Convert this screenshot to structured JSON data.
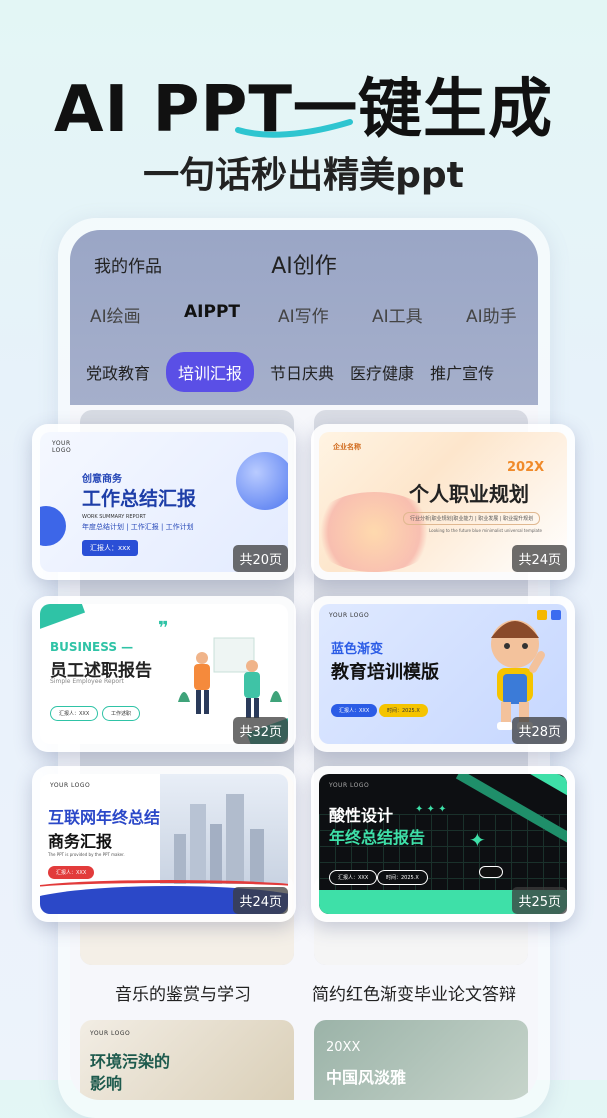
{
  "headline": "AI PPT一键生成",
  "subline": "一句话秒出精美ppt",
  "header": {
    "left": "我的作品",
    "title": "AI创作"
  },
  "tabs": [
    {
      "label": "AI绘画",
      "active": false
    },
    {
      "label": "AIPPT",
      "active": true
    },
    {
      "label": "AI写作",
      "active": false
    },
    {
      "label": "AI工具",
      "active": false
    },
    {
      "label": "AI助手",
      "active": false
    }
  ],
  "categories": [
    {
      "label": "党政教育",
      "active": false
    },
    {
      "label": "培训汇报",
      "active": true
    },
    {
      "label": "节日庆典",
      "active": false
    },
    {
      "label": "医疗健康",
      "active": false
    },
    {
      "label": "推广宣传",
      "active": false
    }
  ],
  "accent": "#5a4fe6",
  "templates": [
    {
      "pages": "共20页",
      "logo": "YOUR LOGO",
      "small": "创意商务",
      "title": "工作总结汇报",
      "en": "WORK SUMMARY REPORT",
      "items": "年度总结计划 | 工作汇报 | 工作计划",
      "reporter": "汇报人：xxx"
    },
    {
      "pages": "共24页",
      "company": "企业名称",
      "year": "202X",
      "title": "个人职业规划",
      "desc": "行业分析|职业规划|职业能力 | 职业发展 | 职业提升规划",
      "en": "Looking to the future blue minimalist universal template"
    },
    {
      "pages": "共32页",
      "title_en": "BUSINESS —",
      "title": "员工述职报告",
      "sub": "Simple Employee Report",
      "reporter": "汇报人：XXX",
      "dept": "工作述职"
    },
    {
      "pages": "共28页",
      "logo": "YOUR LOGO",
      "title1": "蓝色渐变",
      "title2": "教育培训模版",
      "reporter": "汇报人：XXX",
      "date": "时间：2025.X"
    },
    {
      "pages": "共24页",
      "logo": "YOUR LOGO",
      "title1": "互联网年终总结",
      "title2": "商务汇报",
      "desc": "The PPT is provided by the PPT maker.",
      "reporter": "汇报人：XXX"
    },
    {
      "pages": "共25页",
      "logo": "YOUR LOGO",
      "title1": "酸性设计",
      "title2": "年终总结报告",
      "reporter": "汇报人：XXX",
      "date": "时间：2025.X"
    }
  ],
  "bottom_cards": [
    {
      "label": "音乐的鉴赏与学习"
    },
    {
      "label": "简约红色渐变毕业论文答辩"
    }
  ],
  "peek_cards": [
    {
      "logo": "YOUR LOGO",
      "title": "环境污染的",
      "title2": "影响"
    },
    {
      "year": "20XX",
      "title": "中国风淡雅"
    }
  ],
  "partial_year": "202"
}
